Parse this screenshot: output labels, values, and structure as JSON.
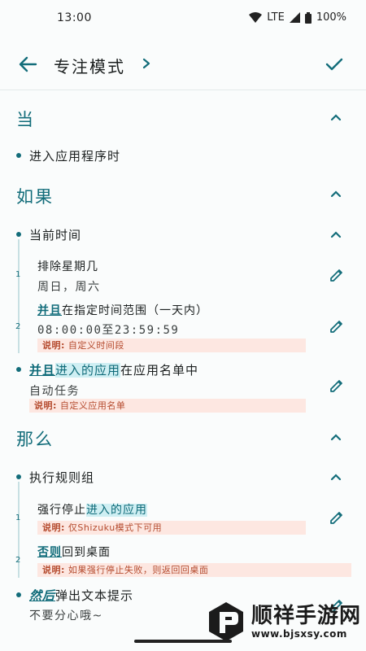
{
  "status_bar": {
    "time": "13:00",
    "network": "LTE",
    "battery": "100%"
  },
  "app_bar": {
    "title": "专注模式"
  },
  "when": {
    "heading": "当",
    "trigger": "进入应用程序时"
  },
  "if": {
    "heading": "如果",
    "group_title": "当前时间",
    "conditions": [
      {
        "index": "1",
        "title": "排除星期几",
        "value": "周日，周六"
      },
      {
        "index": "2",
        "keyword": "并且",
        "title": "在指定时间范围（一天内）",
        "value": "08:00:00至23:59:59",
        "note_label": "说明:",
        "note": "自定义时间段"
      }
    ],
    "app_condition": {
      "keyword": "并且",
      "highlight": "进入的应用",
      "rest": "在应用名单中",
      "value": "自动任务",
      "note_label": "说明:",
      "note": "自定义应用名单"
    }
  },
  "then": {
    "heading": "那么",
    "group_title": "执行规则组",
    "actions": [
      {
        "index": "1",
        "title": "强行停止",
        "highlight": "进入的应用",
        "note_label": "说明:",
        "note": "仅Shizuku模式下可用"
      },
      {
        "index": "2",
        "keyword": "否则",
        "title": "回到桌面",
        "note_label": "说明:",
        "note": "如果强行停止失败，则返回回桌面"
      }
    ],
    "last_action": {
      "keyword": "然后",
      "title": "弹出文本提示",
      "value": "不要分心哦~"
    }
  },
  "watermark": {
    "name": "顺祥手游网",
    "url": "www.bjsxsy.com"
  },
  "colors": {
    "accent": "#136d7a",
    "note_bg": "#fde7e1",
    "note_text": "#b54b2e",
    "highlight_bg": "#cfeff3"
  }
}
